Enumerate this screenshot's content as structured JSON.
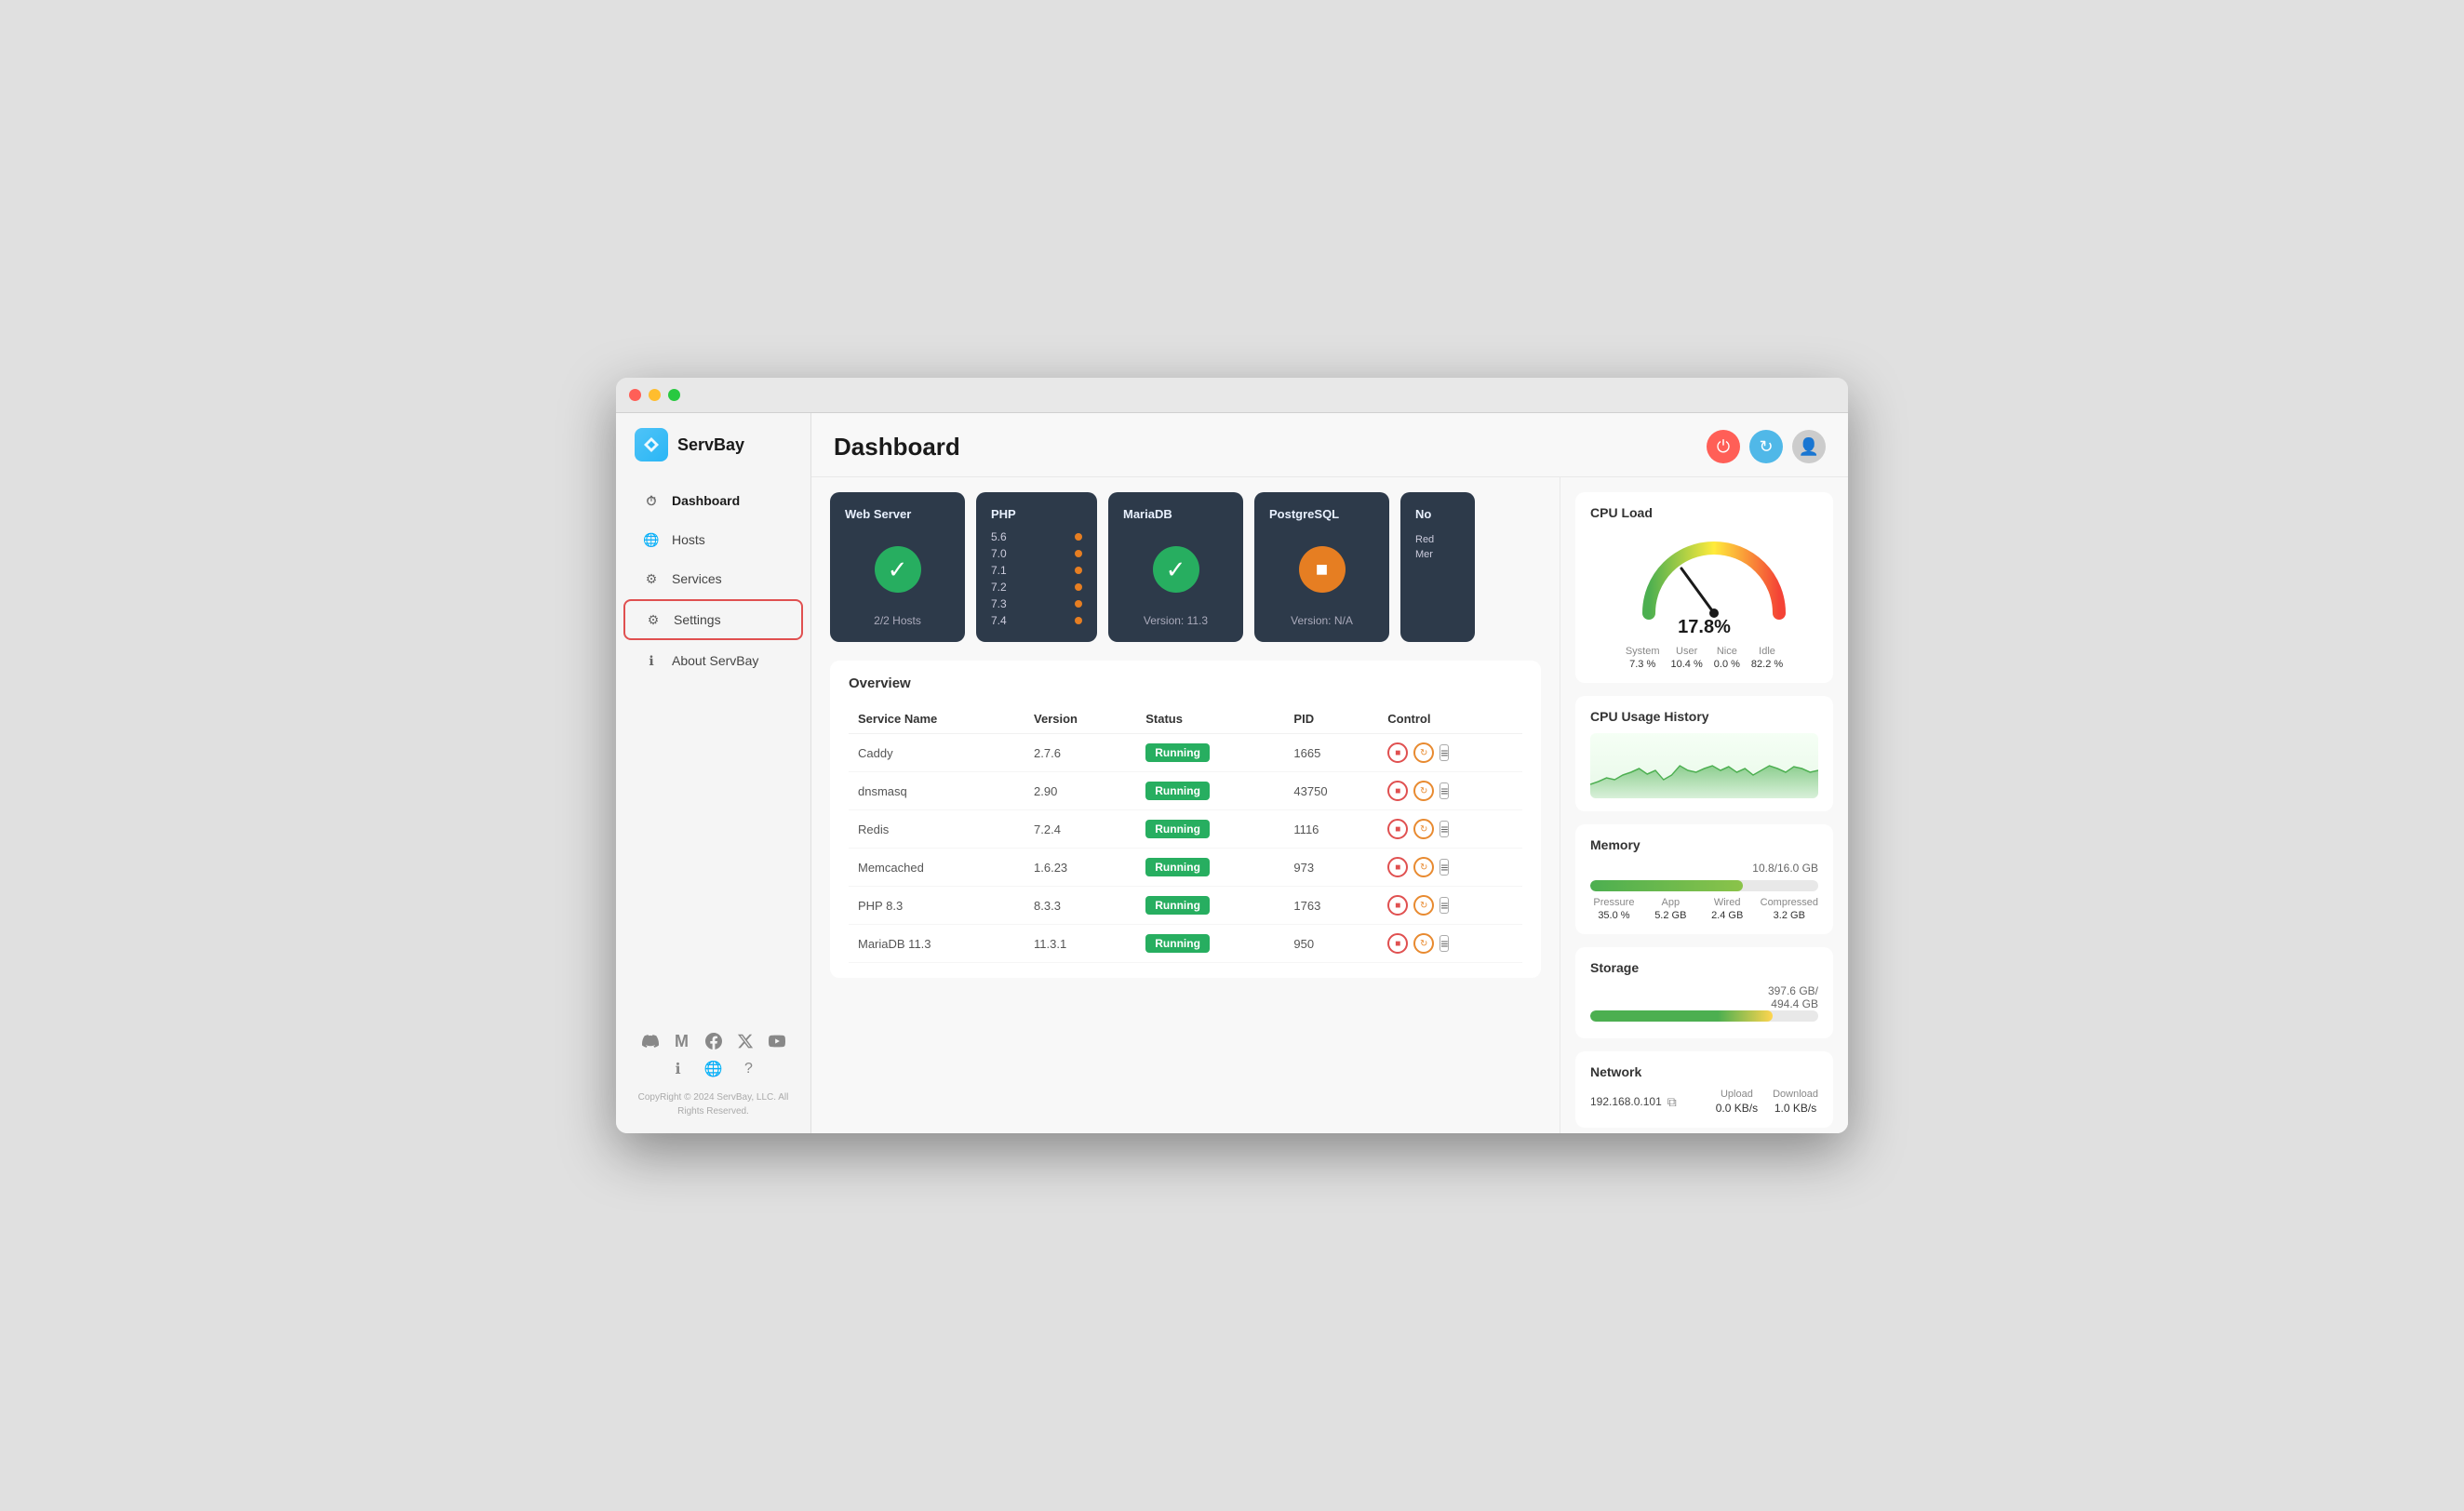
{
  "window": {
    "title": "ServBay"
  },
  "titlebar": {
    "traffic_lights": [
      "red",
      "yellow",
      "green"
    ]
  },
  "sidebar": {
    "logo_text": "ServBay",
    "nav_items": [
      {
        "id": "dashboard",
        "label": "Dashboard",
        "icon": "clock"
      },
      {
        "id": "hosts",
        "label": "Hosts",
        "icon": "globe"
      },
      {
        "id": "services",
        "label": "Services",
        "icon": "layers"
      },
      {
        "id": "settings",
        "label": "Settings",
        "icon": "gear",
        "selected": true
      },
      {
        "id": "about",
        "label": "About ServBay",
        "icon": "info"
      }
    ],
    "social_icons": [
      "discord",
      "medium",
      "facebook",
      "twitter",
      "youtube"
    ],
    "bottom_icons": [
      "info",
      "globe",
      "help"
    ],
    "copyright": "CopyRight © 2024 ServBay, LLC.\nAll Rights Reserved."
  },
  "header": {
    "title": "Dashboard",
    "buttons": {
      "power": "⏻",
      "refresh": "↻",
      "user": "👤"
    }
  },
  "service_cards": [
    {
      "id": "webserver",
      "title": "Web Server",
      "status": "running",
      "subtitle": "2/2 Hosts"
    },
    {
      "id": "php",
      "title": "PHP",
      "versions": [
        "5.6",
        "7.0",
        "7.1",
        "7.2",
        "7.3",
        "7.4"
      ]
    },
    {
      "id": "mariadb",
      "title": "MariaDB",
      "status": "running",
      "subtitle": "Version: 11.3"
    },
    {
      "id": "postgresql",
      "title": "PostgreSQL",
      "status": "stopped",
      "subtitle": "Version: N/A"
    },
    {
      "id": "partial",
      "title": "No",
      "lines": [
        "Red",
        "Mer"
      ]
    }
  ],
  "overview": {
    "title": "Overview",
    "table": {
      "headers": [
        "Service Name",
        "Version",
        "Status",
        "PID",
        "Control"
      ],
      "rows": [
        {
          "name": "Caddy",
          "version": "2.7.6",
          "status": "Running",
          "pid": "1665"
        },
        {
          "name": "dnsmasq",
          "version": "2.90",
          "status": "Running",
          "pid": "43750"
        },
        {
          "name": "Redis",
          "version": "7.2.4",
          "status": "Running",
          "pid": "1116"
        },
        {
          "name": "Memcached",
          "version": "1.6.23",
          "status": "Running",
          "pid": "973"
        },
        {
          "name": "PHP 8.3",
          "version": "8.3.3",
          "status": "Running",
          "pid": "1763"
        },
        {
          "name": "MariaDB 11.3",
          "version": "11.3.1",
          "status": "Running",
          "pid": "950"
        }
      ]
    }
  },
  "right_panel": {
    "cpu_load": {
      "title": "CPU Load",
      "percent": "17.8%",
      "stats": [
        {
          "label": "System",
          "value": "7.3 %"
        },
        {
          "label": "User",
          "value": "10.4 %"
        },
        {
          "label": "Nice",
          "value": "0.0 %"
        },
        {
          "label": "Idle",
          "value": "82.2 %"
        }
      ]
    },
    "cpu_history": {
      "title": "CPU Usage History"
    },
    "memory": {
      "title": "Memory",
      "used": 10.8,
      "total": 16.0,
      "fill_percent": 67,
      "display": "10.8/16.0 GB",
      "stats": [
        {
          "label": "Pressure",
          "value": "35.0 %"
        },
        {
          "label": "App",
          "value": "5.2 GB"
        },
        {
          "label": "Wired",
          "value": "2.4 GB"
        },
        {
          "label": "Compressed",
          "value": "3.2 GB"
        }
      ]
    },
    "storage": {
      "title": "Storage",
      "used": 397.6,
      "total": 494.4,
      "fill_percent": 80,
      "display": "397.6 GB/\n494.4 GB"
    },
    "network": {
      "title": "Network",
      "ip": "192.168.0.101",
      "upload_label": "Upload",
      "upload_value": "0.0 KB/s",
      "download_label": "Download",
      "download_value": "1.0 KB/s"
    }
  }
}
